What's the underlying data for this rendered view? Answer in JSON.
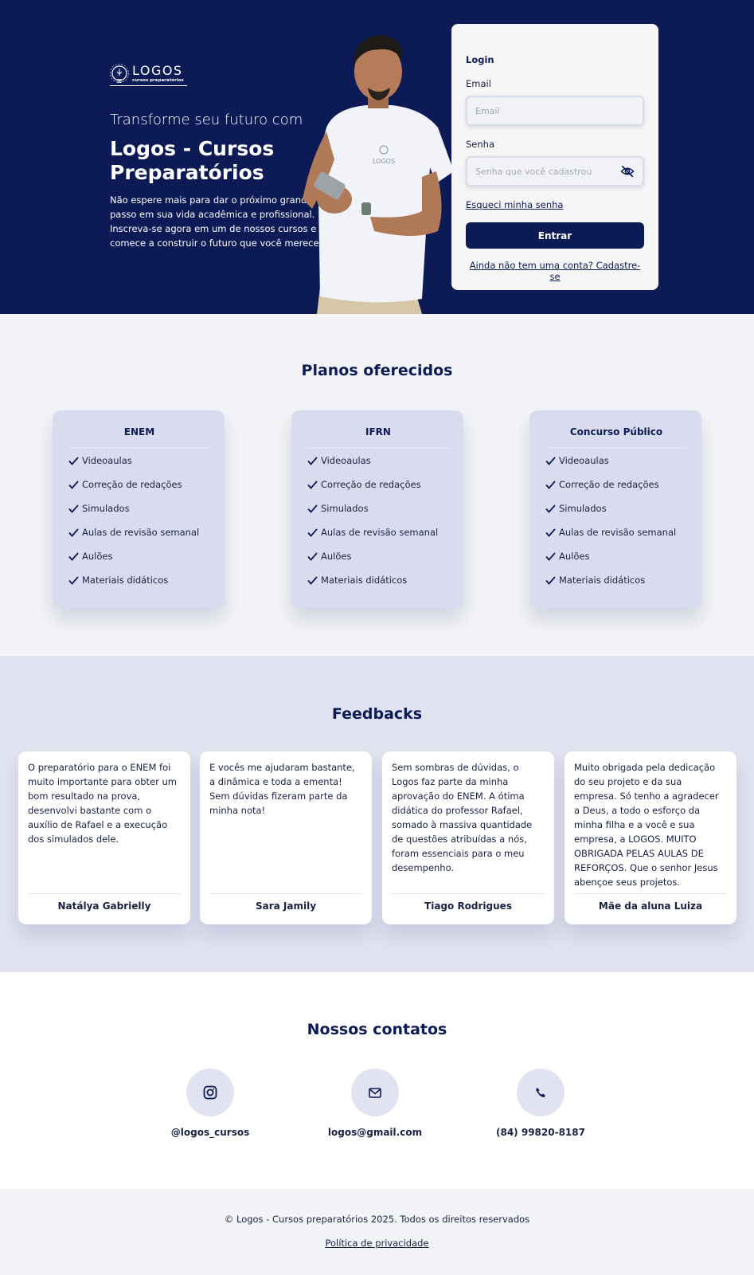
{
  "brand": {
    "name": "LOGOS",
    "tagline": "cursos preparatórios"
  },
  "hero": {
    "subtitle": "Transforme seu futuro com",
    "title": "Logos - Cursos Preparatórios",
    "description": "Não espere mais para dar o próximo grande passo em sua vida acadêmica e profissional. Inscreva-se agora em um de nossos cursos e comece a construir o futuro que você merece!"
  },
  "login": {
    "title": "Login",
    "email_label": "Email",
    "email_placeholder": "Email",
    "password_label": "Senha",
    "password_placeholder": "Senha que você cadastrou",
    "forgot_link": "Esqueci minha senha",
    "submit_label": "Entrar",
    "signup_link": "Ainda não tem uma conta? Cadastre-se"
  },
  "plans": {
    "title": "Planos oferecidos",
    "items": [
      {
        "name": "ENEM",
        "features": [
          "Videoaulas",
          "Correção de redações",
          "Simulados",
          "Aulas de revisão semanal",
          "Aulões",
          "Materiais didáticos"
        ]
      },
      {
        "name": "IFRN",
        "features": [
          "Videoaulas",
          "Correção de redações",
          "Simulados",
          "Aulas de revisão semanal",
          "Aulões",
          "Materiais didáticos"
        ]
      },
      {
        "name": "Concurso Público",
        "features": [
          "Videoaulas",
          "Correção de redações",
          "Simulados",
          "Aulas de revisão semanal",
          "Aulões",
          "Materiais didáticos"
        ]
      }
    ]
  },
  "feedbacks": {
    "title": "Feedbacks",
    "items": [
      {
        "text": "O preparatório para o ENEM foi muito importante para obter um bom resultado na prova, desenvolvi bastante com o auxílio de Rafael e a execução dos simulados dele.",
        "author": "Natálya Gabrielly"
      },
      {
        "text": "E vocês me ajudaram bastante, a dinâmica e toda a ementa! Sem dúvidas fizeram parte da minha nota!",
        "author": "Sara Jamily"
      },
      {
        "text": "Sem sombras de dúvidas, o Logos faz parte da minha aprovação do ENEM. A ótima didática do professor Rafael, somado à massiva quantidade de questões atribuídas a nós, foram essenciais para o meu desempenho.",
        "author": "Tiago Rodrigues"
      },
      {
        "text": "Muito obrigada pela dedicação do seu projeto e da sua empresa. Só tenho a agradecer a Deus, a todo o esforço da minha filha e a você e sua empresa, a LOGOS. MUITO OBRIGADA PELAS AULAS DE REFORÇOS. Que o senhor Jesus abençoe seus projetos.",
        "author": "Mãe da aluna Luiza"
      }
    ]
  },
  "contacts": {
    "title": "Nossos contatos",
    "items": [
      {
        "icon": "instagram-icon",
        "label": "@logos_cursos"
      },
      {
        "icon": "mail-icon",
        "label": "logos@gmail.com"
      },
      {
        "icon": "phone-icon",
        "label": "(84) 99820-8187"
      }
    ]
  },
  "footer": {
    "copyright": "© Logos - Cursos preparatórios 2025. Todos os direitos reservados",
    "privacy_link": "Política de privacidade"
  },
  "colors": {
    "primary": "#0c1b56",
    "plan_card": "#d9dcee",
    "feedback_bg": "#e1e3f1",
    "page_bg": "#f3f4f7"
  }
}
